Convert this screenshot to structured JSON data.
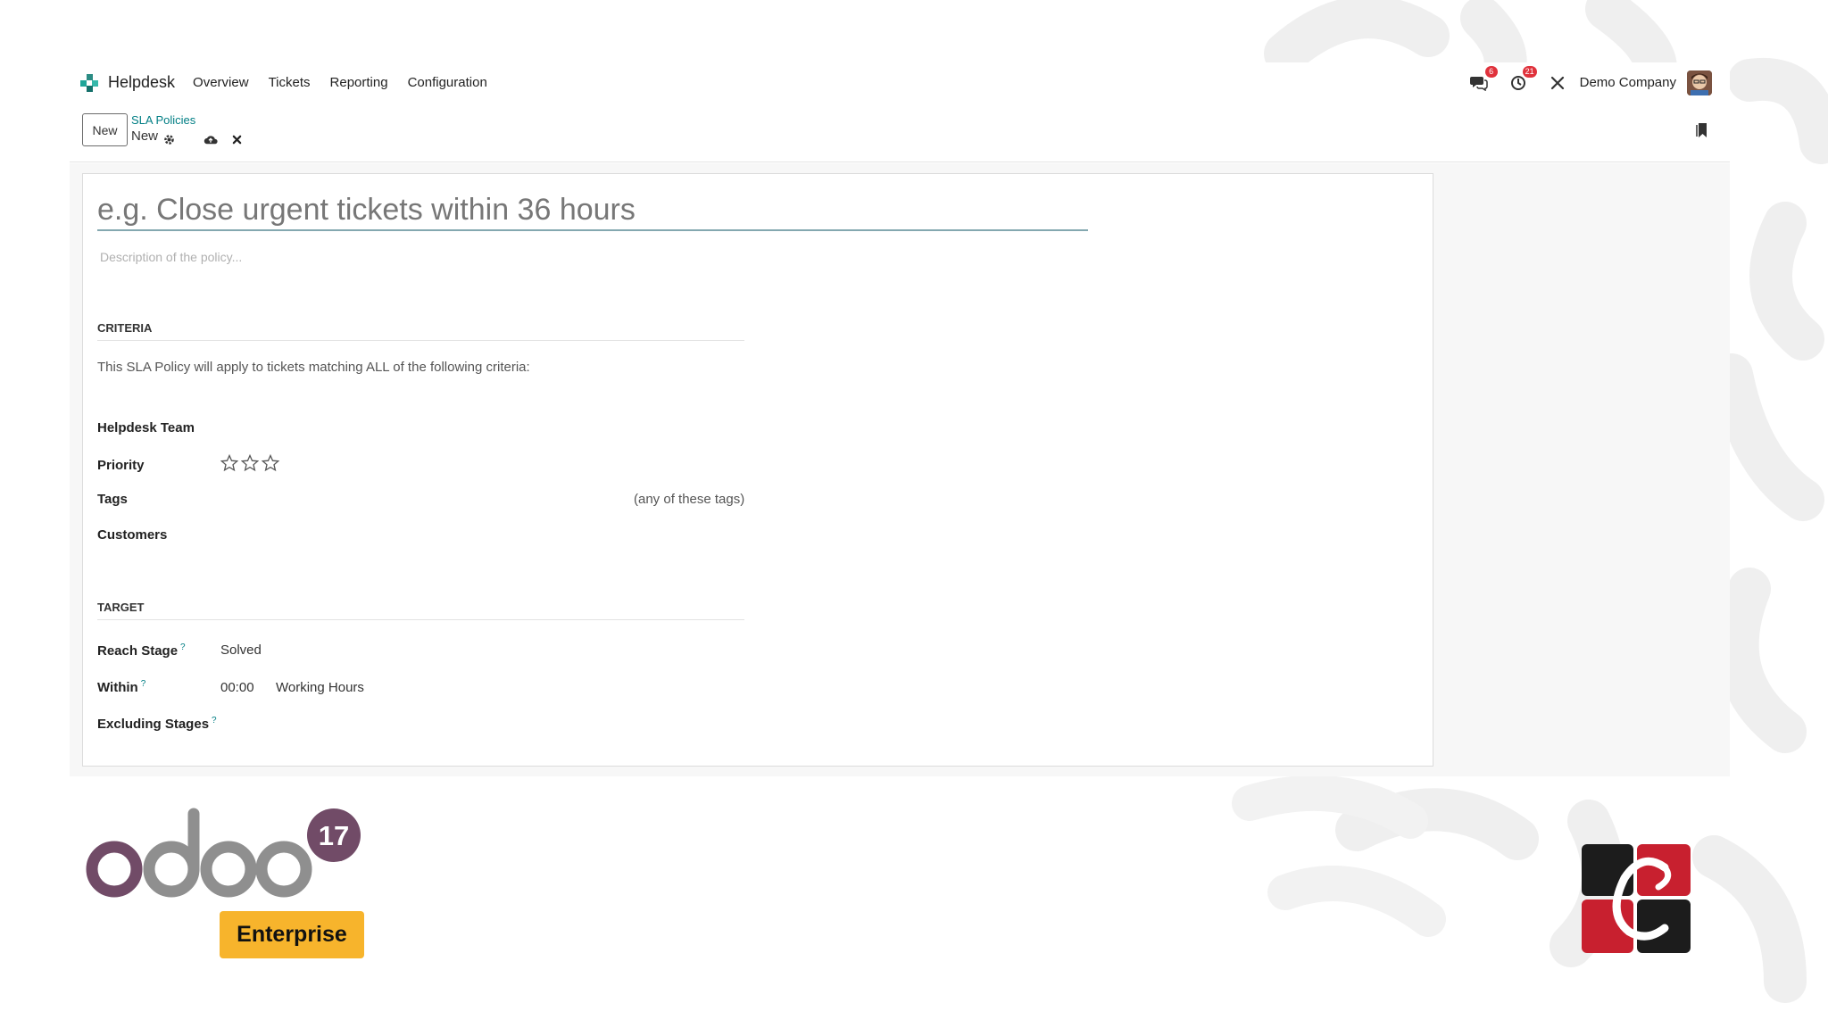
{
  "navbar": {
    "app_name": "Helpdesk",
    "menu": [
      "Overview",
      "Tickets",
      "Reporting",
      "Configuration"
    ],
    "messages_badge": "6",
    "activities_badge": "21",
    "company": "Demo Company"
  },
  "control_panel": {
    "new_label": "New",
    "breadcrumb_parent": "SLA Policies",
    "breadcrumb_current": "New"
  },
  "form": {
    "title_placeholder": "e.g. Close urgent tickets within 36 hours",
    "description_placeholder": "Description of the policy...",
    "criteria": {
      "heading": "CRITERIA",
      "note": "This SLA Policy will apply to tickets matching ALL of the following criteria:",
      "helpdesk_team_label": "Helpdesk Team",
      "priority_label": "Priority",
      "priority_stars": 0,
      "tags_label": "Tags",
      "tags_hint": "(any of these tags)",
      "customers_label": "Customers"
    },
    "target": {
      "heading": "TARGET",
      "reach_stage_label": "Reach Stage",
      "reach_stage_value": "Solved",
      "within_label": "Within",
      "within_value": "00:00",
      "within_unit": "Working Hours",
      "excluding_stages_label": "Excluding Stages",
      "help_mark": "?"
    }
  },
  "branding": {
    "odoo_version": "17",
    "edition": "Enterprise"
  },
  "colors": {
    "accent_teal": "#017e84",
    "odoo_purple": "#714b67",
    "enterprise_yellow": "#f7b42c",
    "badge_red": "#e0323c"
  }
}
